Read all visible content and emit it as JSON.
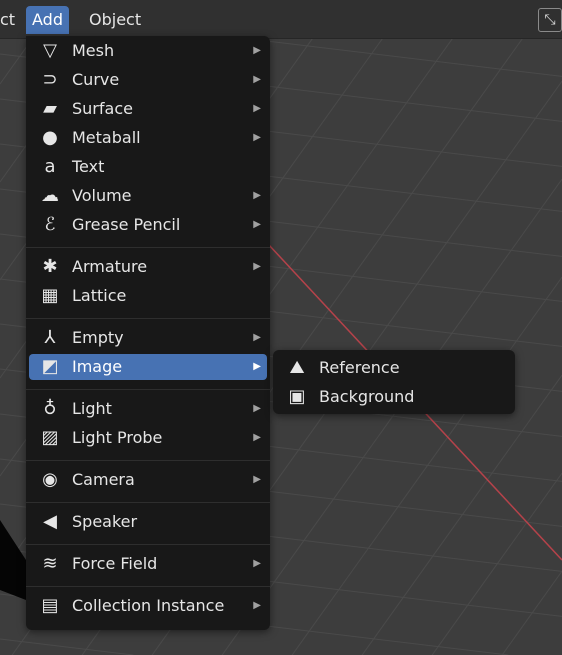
{
  "topbar": {
    "prev_label": "ct",
    "add_label": "Add",
    "object_label": "Object",
    "gizmo_icon": "axis-toggle-icon"
  },
  "add_menu": {
    "groups": [
      [
        {
          "label": "Mesh",
          "icon": "mesh-icon",
          "glyph": "▽",
          "submenu": true
        },
        {
          "label": "Curve",
          "icon": "curve-icon",
          "glyph": "⊃",
          "submenu": true
        },
        {
          "label": "Surface",
          "icon": "surface-icon",
          "glyph": "▰",
          "submenu": true
        },
        {
          "label": "Metaball",
          "icon": "metaball-icon",
          "glyph": "●",
          "submenu": true
        },
        {
          "label": "Text",
          "icon": "text-icon",
          "glyph": "a",
          "submenu": false
        },
        {
          "label": "Volume",
          "icon": "volume-icon",
          "glyph": "☁",
          "submenu": true
        },
        {
          "label": "Grease Pencil",
          "icon": "grease-pencil-icon",
          "glyph": "ℰ",
          "submenu": true
        }
      ],
      [
        {
          "label": "Armature",
          "icon": "armature-icon",
          "glyph": "✱",
          "submenu": true
        },
        {
          "label": "Lattice",
          "icon": "lattice-icon",
          "glyph": "▦",
          "submenu": false
        }
      ],
      [
        {
          "label": "Empty",
          "icon": "empty-icon",
          "glyph": "⅄",
          "submenu": true
        },
        {
          "label": "Image",
          "icon": "image-icon",
          "glyph": "◩",
          "submenu": true,
          "highlighted": true
        }
      ],
      [
        {
          "label": "Light",
          "icon": "light-icon",
          "glyph": "♁",
          "submenu": true
        },
        {
          "label": "Light Probe",
          "icon": "light-probe-icon",
          "glyph": "▨",
          "submenu": true
        }
      ],
      [
        {
          "label": "Camera",
          "icon": "camera-icon",
          "glyph": "◉",
          "submenu": true
        }
      ],
      [
        {
          "label": "Speaker",
          "icon": "speaker-icon",
          "glyph": "◀",
          "submenu": false
        }
      ],
      [
        {
          "label": "Force Field",
          "icon": "force-field-icon",
          "glyph": "≋",
          "submenu": true
        }
      ],
      [
        {
          "label": "Collection Instance",
          "icon": "collection-instance-icon",
          "glyph": "▤",
          "submenu": true
        }
      ]
    ],
    "submenu_arrow": "▶"
  },
  "image_submenu": {
    "items": [
      {
        "label": "Reference",
        "icon": "image-reference-icon",
        "glyph": "⛰"
      },
      {
        "label": "Background",
        "icon": "image-background-icon",
        "glyph": "▣"
      }
    ]
  },
  "colors": {
    "accent": "#4772b3",
    "menu_bg": "#181818",
    "viewport_bg": "#3d3d3d",
    "x_axis": "#b5424a"
  }
}
